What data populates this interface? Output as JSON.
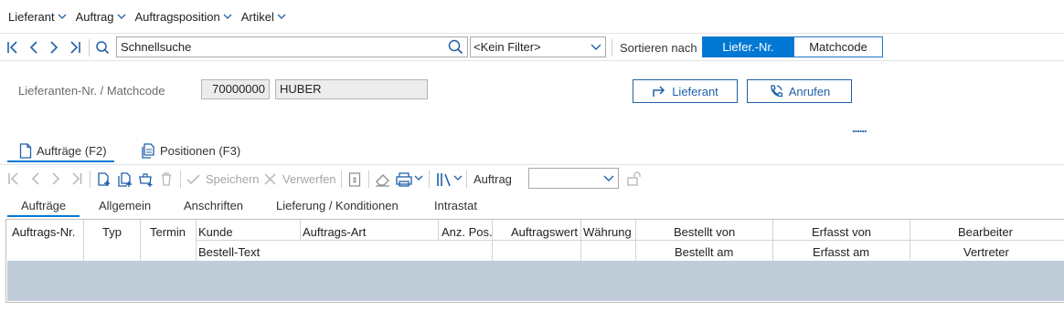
{
  "menu": {
    "items": [
      {
        "label": "Lieferant"
      },
      {
        "label": "Auftrag"
      },
      {
        "label": "Auftragsposition"
      },
      {
        "label": "Artikel"
      }
    ]
  },
  "navbar": {
    "search_value": "Schnellsuche",
    "filter_value": "<Kein Filter>",
    "sort_label": "Sortieren nach",
    "sort_options": [
      "Liefer.-Nr.",
      "Matchcode"
    ],
    "sort_active": "Liefer.-Nr."
  },
  "header": {
    "field_label": "Lieferanten-Nr. / Matchcode",
    "supplier_number": "70000000",
    "matchcode": "HUBER",
    "lieferant_button": "Lieferant",
    "anrufen_button": "Anrufen",
    "more_indicator": "......"
  },
  "tabs": [
    {
      "label": "Aufträge (F2)",
      "active": true
    },
    {
      "label": "Positionen (F3)",
      "active": false
    }
  ],
  "toolbar": {
    "save_label": "Speichern",
    "discard_label": "Verwerfen",
    "auftrag_label": "Auftrag",
    "auftrag_value": ""
  },
  "subtabs": [
    {
      "label": "Aufträge",
      "active": true
    },
    {
      "label": "Allgemein"
    },
    {
      "label": "Anschriften"
    },
    {
      "label": "Lieferung / Konditionen"
    },
    {
      "label": "Intrastat"
    }
  ],
  "grid": {
    "columns_row1": [
      "Auftrags-Nr.",
      "Typ",
      "Termin",
      "Kunde",
      "Auftrags-Art",
      "Anz. Pos.",
      "Auftragswert",
      "Währung",
      "Bestellt von",
      "Erfasst von",
      "Bearbeiter"
    ],
    "columns_row2": [
      "Bestell-Text",
      "Bestellt am",
      "Erfasst am",
      "Vertreter"
    ]
  },
  "colors": {
    "accent": "#0078d4",
    "selected_row": "#c0cdd9",
    "button_border": "#1f5fa8"
  }
}
